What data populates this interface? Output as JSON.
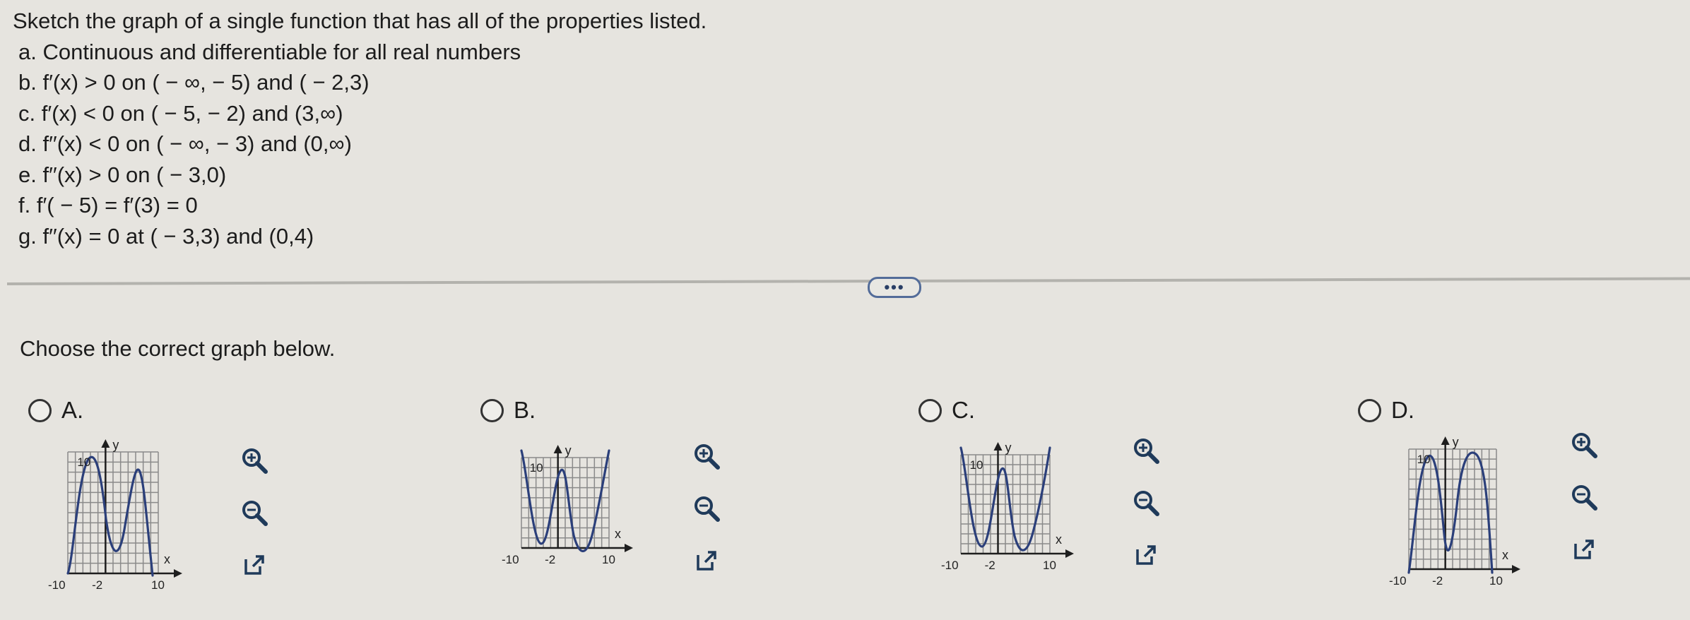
{
  "question": {
    "title": "Sketch the graph of a single function that has all of the properties listed.",
    "items": [
      "a. Continuous and differentiable for all real numbers",
      "b. f′(x) > 0 on ( − ∞, − 5) and ( − 2,3)",
      "c. f′(x) < 0 on ( − 5, − 2) and (3,∞)",
      "d. f′′(x) < 0 on ( − ∞, − 3) and (0,∞)",
      "e. f′′(x) > 0 on ( − 3,0)",
      "f. f′( − 5) = f′(3) = 0",
      "g. f′′(x) = 0 at ( − 3,3) and (0,4)"
    ]
  },
  "more_label": "•••",
  "prompt": "Choose the correct graph below.",
  "options": [
    {
      "id": "A",
      "label": "A."
    },
    {
      "id": "B",
      "label": "B."
    },
    {
      "id": "C",
      "label": "C."
    },
    {
      "id": "D",
      "label": "D."
    }
  ],
  "graph_labels": {
    "y_axis": "y",
    "x_axis": "x",
    "y_tick": "10",
    "x_min": "-10",
    "x_mid": "-2",
    "x_max": "10"
  },
  "icons": {
    "zoom_in": "zoom-in-icon",
    "zoom_out": "zoom-out-icon",
    "open": "external-link-icon"
  },
  "colors": {
    "curve": "#2b3f7a",
    "grid": "#8a8a8a",
    "axis": "#1e1e1e",
    "accent": "#536c99"
  }
}
